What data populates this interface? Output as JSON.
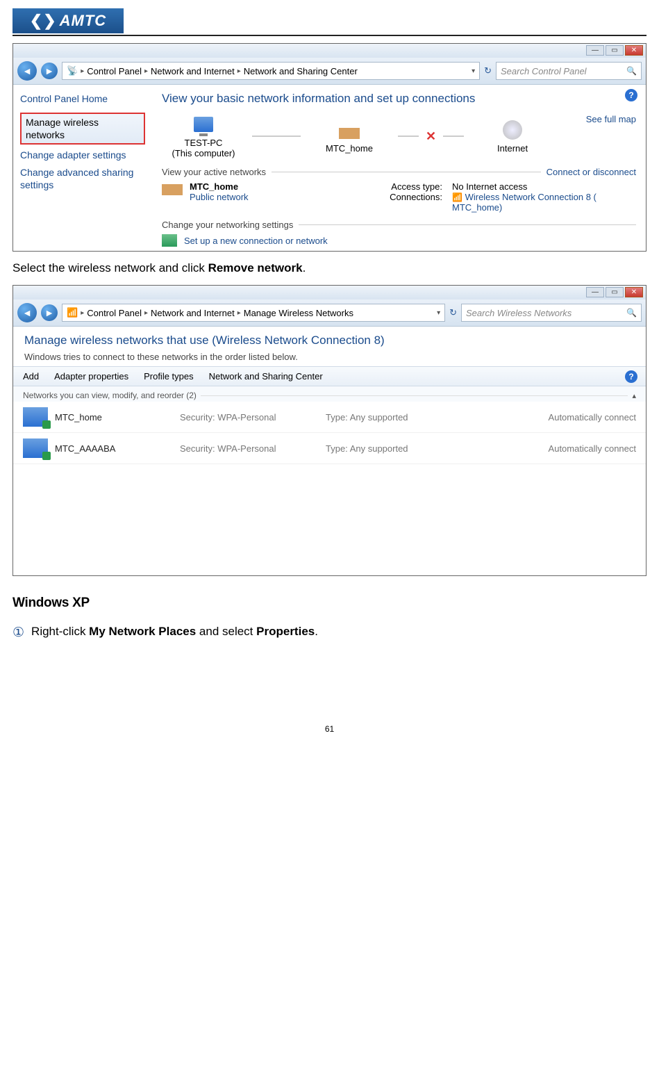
{
  "brand": "AMTC",
  "page_number": "61",
  "instruction1_pre": "Select the wireless network and click ",
  "instruction1_bold": "Remove network",
  "instruction1_post": ".",
  "section_heading": "Windows XP",
  "step1_num": "①",
  "step1_pre": "Right-click ",
  "step1_b1": "My Network Places",
  "step1_mid": " and select ",
  "step1_b2": "Properties",
  "step1_post": ".",
  "s1": {
    "breadcrumb": [
      "Control Panel",
      "Network and Internet",
      "Network and Sharing Center"
    ],
    "search_placeholder": "Search Control Panel",
    "sidebar": {
      "home": "Control Panel Home",
      "links": [
        "Manage wireless networks",
        "Change adapter settings",
        "Change advanced sharing settings"
      ]
    },
    "main_title": "View your basic network information and set up connections",
    "see_full_map": "See full map",
    "nodes": {
      "pc_name": "TEST-PC",
      "pc_sub": "(This computer)",
      "mid": "MTC_home",
      "internet": "Internet"
    },
    "active_label": "View your active networks",
    "connect_link": "Connect or disconnect",
    "active": {
      "name": "MTC_home",
      "type": "Public network",
      "access_label": "Access type:",
      "access_value": "No Internet access",
      "conn_label": "Connections:",
      "conn_value": "Wireless Network Connection 8 (  MTC_home)"
    },
    "change_label": "Change your networking settings",
    "setup_link": "Set up a new connection or network"
  },
  "s2": {
    "breadcrumb": [
      "Control Panel",
      "Network and Internet",
      "Manage Wireless Networks"
    ],
    "search_placeholder": "Search Wireless Networks",
    "title": "Manage wireless networks that use (Wireless Network Connection 8)",
    "subtitle": "Windows tries to connect to these networks in the order listed below.",
    "toolbar": [
      "Add",
      "Adapter properties",
      "Profile types",
      "Network and Sharing Center"
    ],
    "group_label": "Networks you can view, modify, and reorder (2)",
    "cols": {
      "sec": "Security:",
      "type": "Type:"
    },
    "rows": [
      {
        "name": "MTC_home",
        "security": "WPA-Personal",
        "type": "Any supported",
        "mode": "Automatically connect"
      },
      {
        "name": "MTC_AAAABA",
        "security": "WPA-Personal",
        "type": "Any supported",
        "mode": "Automatically connect"
      }
    ]
  }
}
